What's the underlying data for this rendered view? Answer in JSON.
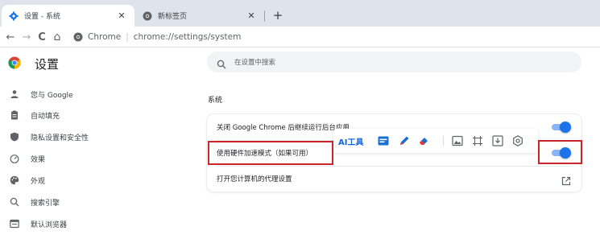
{
  "tabs": [
    {
      "title": "设置 - 系统",
      "active": true,
      "close": "✕"
    },
    {
      "title": "新标签页",
      "active": false,
      "close": "✕"
    }
  ],
  "new_tab": "+",
  "toolbar": {
    "back": "←",
    "forward": "→",
    "reload": "C",
    "home": "⌂",
    "site_chip": "Chrome",
    "separator": "|",
    "url": "chrome://settings/system"
  },
  "page": {
    "title": "设置",
    "search_placeholder": "在设置中搜索"
  },
  "sidebar": {
    "items": [
      {
        "label": "您与 Google",
        "icon": "person-icon"
      },
      {
        "label": "自动填充",
        "icon": "clipboard-icon"
      },
      {
        "label": "隐私设置和安全性",
        "icon": "shield-icon"
      },
      {
        "label": "效果",
        "icon": "gauge-icon"
      },
      {
        "label": "外观",
        "icon": "palette-icon"
      },
      {
        "label": "搜索引擎",
        "icon": "search-icon"
      },
      {
        "label": "默认浏览器",
        "icon": "browser-icon"
      }
    ]
  },
  "system": {
    "section_title": "系统",
    "rows": [
      {
        "label": "关闭 Google Chrome 后继续运行后台应用",
        "control": "toggle",
        "on": true
      },
      {
        "label": "使用硬件加速模式（如果可用）",
        "control": "toggle",
        "on": true
      },
      {
        "label": "打开您计算机的代理设置",
        "control": "external-link"
      }
    ]
  },
  "floating_toolbar": {
    "ai_label": "AI工具",
    "icons": [
      "hd-icon",
      "pen-icon",
      "eraser-icon",
      "image-icon",
      "crop-icon",
      "download-icon",
      "settings-icon"
    ]
  },
  "colors": {
    "accent": "#1a73e8",
    "highlight": "#c9252b",
    "tabstrip": "#dfe3eb"
  }
}
